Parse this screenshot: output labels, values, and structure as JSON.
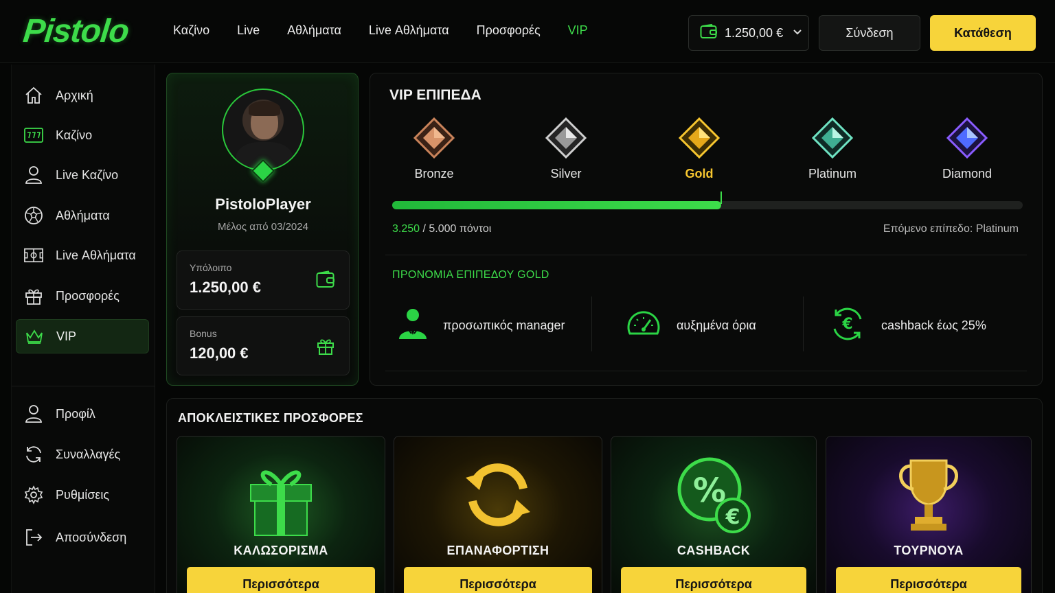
{
  "brand": {
    "logo_text": "Pistolo"
  },
  "topnav": {
    "items": [
      {
        "label": "Καζίνο"
      },
      {
        "label": "Live"
      },
      {
        "label": "Αθλήματα"
      },
      {
        "label": "Live Αθλήματα"
      },
      {
        "label": "Προσφορές"
      },
      {
        "label": "VIP"
      }
    ]
  },
  "header": {
    "wallet_amount": "1.250,00 €",
    "login_label": "Σύνδεση",
    "deposit_label": "Κατάθεση"
  },
  "sidebar": {
    "items": [
      {
        "label": "Αρχική",
        "icon": "home-icon"
      },
      {
        "label": "Καζίνο",
        "icon": "slot-machine-icon"
      },
      {
        "label": "Live Καζίνο",
        "icon": "user-icon"
      },
      {
        "label": "Αθλήματα",
        "icon": "soccer-ball-icon"
      },
      {
        "label": "Live Αθλήματα",
        "icon": "field-icon"
      },
      {
        "label": "Προσφορές",
        "icon": "gift-icon"
      },
      {
        "label": "VIP",
        "icon": "crown-icon"
      }
    ],
    "account_items": [
      {
        "label": "Προφίλ",
        "icon": "user-icon"
      },
      {
        "label": "Συναλλαγές",
        "icon": "refresh-icon"
      },
      {
        "label": "Ρυθμίσεις",
        "icon": "gear-icon"
      },
      {
        "label": "Αποσύνδεση",
        "icon": "logout-icon"
      }
    ]
  },
  "profile": {
    "username": "PistoloPlayer",
    "member_since": "Μέλος από 03/2024",
    "balance_label": "Υπόλοιπο",
    "balance_value": "1.250,00 €",
    "bonus_label": "Bonus",
    "bonus_value": "120,00 €"
  },
  "vip": {
    "title": "VIP ΕΠΙΠΕΔΑ",
    "tiers": [
      {
        "name": "Bronze",
        "color": "#c9835a"
      },
      {
        "name": "Silver",
        "color": "#cfcfcf"
      },
      {
        "name": "Gold",
        "color": "#f7c62f"
      },
      {
        "name": "Platinum",
        "color": "#6fe3c3"
      },
      {
        "name": "Diamond",
        "color": "#8a5cff"
      }
    ],
    "current_tier": "Gold",
    "progress_fraction": 0.5216,
    "points_current": "3.250",
    "points_total": " / 5.000 πόντοι",
    "next_level": "Επόμενο επίπεδο: Platinum",
    "perks_title": "ΠΡΟΝΟΜΙΑ ΕΠΙΠΕΔΟΥ GOLD",
    "perks": [
      {
        "label": "προσωπικός manager",
        "icon": "manager-icon"
      },
      {
        "label": "αυξημένα όρια",
        "icon": "speedometer-icon"
      },
      {
        "label": "cashback έως 25%",
        "icon": "euro-cashback-icon"
      }
    ]
  },
  "offers": {
    "title": "ΑΠΟΚΛΕΙΣΤΙΚΕΣ ΠΡΟΣΦΟΡΕΣ",
    "items": [
      {
        "title": "ΚΑΛΩΣΟΡΙΣΜΑ",
        "button": "Περισσότερα",
        "icon": "gift-box-icon"
      },
      {
        "title": "ΕΠΑΝΑΦΟΡΤΙΣΗ",
        "button": "Περισσότερα",
        "icon": "reload-arrows-icon"
      },
      {
        "title": "CASHBACK",
        "button": "Περισσότερα",
        "icon": "percent-coin-icon"
      },
      {
        "title": "ΤΟΥΡΝΟΥΑ",
        "button": "Περισσότερα",
        "icon": "trophy-icon"
      }
    ]
  },
  "colors": {
    "accent_green": "#3ddc4a",
    "accent_yellow": "#f7d43a",
    "background": "#050605"
  }
}
